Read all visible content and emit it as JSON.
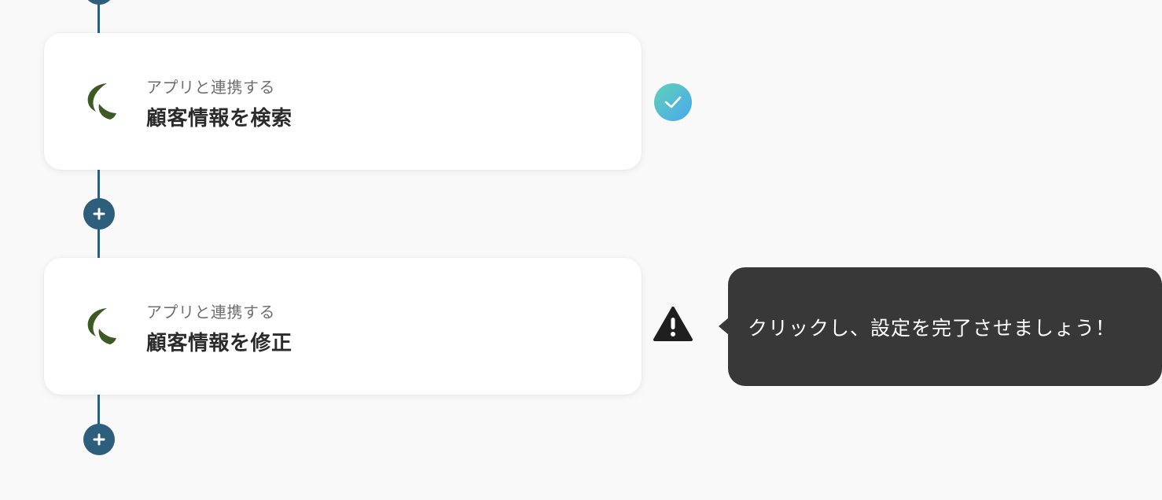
{
  "steps": [
    {
      "caption": "アプリと連携する",
      "title": "顧客情報を検索",
      "app_icon": "app-logo-icon",
      "status": "complete",
      "status_icon": "check-icon"
    },
    {
      "caption": "アプリと連携する",
      "title": "顧客情報を修正",
      "app_icon": "app-logo-icon",
      "status": "incomplete",
      "status_icon": "warning-icon"
    }
  ],
  "tooltip": {
    "text": "クリックし、設定を完了させましょう！"
  },
  "add_button_icon": "plus-icon",
  "colors": {
    "background": "#f9f9f9",
    "flow_line": "#2d5f7c",
    "card": "#ffffff",
    "caption_text": "#6f6f6f",
    "title_text": "#2b2b2b",
    "check_gradient_start": "#5fd1b8",
    "check_gradient_end": "#4aa7ee",
    "warning": "#1f1f1f",
    "tooltip_bg": "#383838",
    "app_logo": "#3d5a25"
  }
}
